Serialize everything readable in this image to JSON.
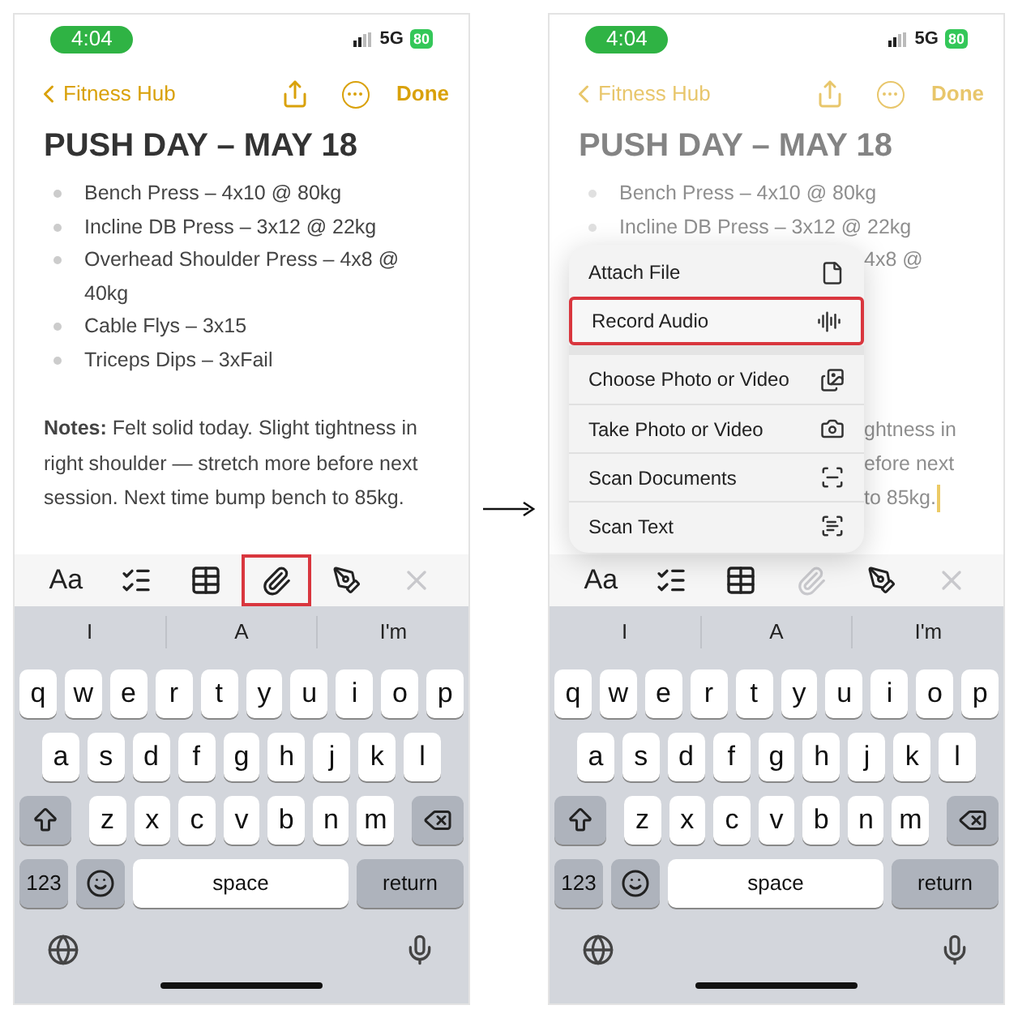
{
  "phones": [
    {
      "dimmed": false,
      "status_bar": {
        "time": "4:04",
        "network": "5G",
        "battery": "80"
      },
      "nav": {
        "back": "Fitness Hub",
        "done": "Done"
      },
      "note": {
        "title": "PUSH DAY – MAY 18",
        "items": [
          "Bench Press – 4x10 @ 80kg",
          "Incline DB Press – 3x12 @ 22kg",
          "Overhead Shoulder Press – 4x8 @ 40kg",
          "Cable Flys – 3x15",
          "Triceps Dips – 3xFail"
        ],
        "notes": "**Notes:** Felt solid today. Slight tightness in right shoulder — stretch more before next session. Next time bump bench to 85kg."
      },
      "toolbar": [
        {
          "kind": "format",
          "label": "Aa",
          "highlighted": false,
          "disabled": false
        },
        {
          "kind": "checklist",
          "highlighted": false,
          "disabled": false
        },
        {
          "kind": "table",
          "highlighted": false,
          "disabled": false
        },
        {
          "kind": "attach",
          "highlighted": true,
          "disabled": false
        },
        {
          "kind": "markup",
          "highlighted": false,
          "disabled": false
        },
        {
          "kind": "close",
          "highlighted": false,
          "disabled": true
        }
      ],
      "keyboard": {
        "suggestions": [
          "I",
          "A",
          "I'm"
        ],
        "rows": [
          [
            "q",
            "w",
            "e",
            "r",
            "t",
            "y",
            "u",
            "i",
            "o",
            "p"
          ],
          [
            "a",
            "s",
            "d",
            "f",
            "g",
            "h",
            "j",
            "k",
            "l"
          ],
          [
            "z",
            "x",
            "c",
            "v",
            "b",
            "n",
            "m"
          ]
        ],
        "numbers": "123",
        "space": "space",
        "return": "return"
      }
    },
    {
      "dimmed": true,
      "status_bar": {
        "time": "4:04",
        "network": "5G",
        "battery": "80"
      },
      "nav": {
        "back": "Fitness Hub",
        "done": "Done"
      },
      "note": {
        "title": "PUSH DAY – MAY 18",
        "items": [
          "Bench Press – 4x10 @ 80kg",
          "Incline DB Press – 3x12 @ 22kg"
        ],
        "fragments": [
          "4x8 @",
          "ghtness in",
          "efore next",
          "to 85kg."
        ],
        "cursor": true
      },
      "menu": {
        "sections": [
          [
            {
              "label": "Attach File",
              "kind": "file",
              "highlighted": false
            },
            {
              "label": "Record Audio",
              "kind": "audio",
              "highlighted": true
            }
          ],
          [
            {
              "label": "Choose Photo or Video",
              "kind": "photos",
              "highlighted": false
            },
            {
              "label": "Take Photo or Video",
              "kind": "camera",
              "highlighted": false
            },
            {
              "label": "Scan Documents",
              "kind": "document",
              "highlighted": false
            },
            {
              "label": "Scan Text",
              "kind": "text",
              "highlighted": false
            }
          ]
        ]
      },
      "toolbar": [
        {
          "kind": "format",
          "label": "Aa",
          "highlighted": false,
          "disabled": false
        },
        {
          "kind": "checklist",
          "highlighted": false,
          "disabled": false
        },
        {
          "kind": "table",
          "highlighted": false,
          "disabled": false
        },
        {
          "kind": "attach",
          "highlighted": false,
          "disabled": true
        },
        {
          "kind": "markup",
          "highlighted": false,
          "disabled": false
        },
        {
          "kind": "close",
          "highlighted": false,
          "disabled": true
        }
      ],
      "keyboard": {
        "suggestions": [
          "I",
          "A",
          "I'm"
        ],
        "rows": [
          [
            "q",
            "w",
            "e",
            "r",
            "t",
            "y",
            "u",
            "i",
            "o",
            "p"
          ],
          [
            "a",
            "s",
            "d",
            "f",
            "g",
            "h",
            "j",
            "k",
            "l"
          ],
          [
            "z",
            "x",
            "c",
            "v",
            "b",
            "n",
            "m"
          ]
        ],
        "numbers": "123",
        "space": "space",
        "return": "return"
      }
    }
  ]
}
